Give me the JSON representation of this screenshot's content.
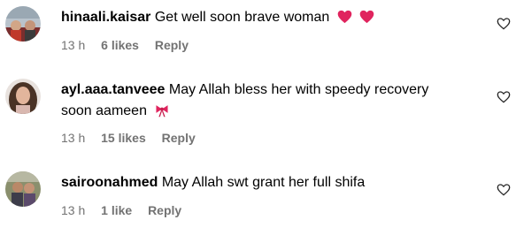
{
  "comments": [
    {
      "username": "hinaali.kaisar",
      "text_line1": "Get well soon brave woman",
      "text_line2": "",
      "emoji": "red-heart-emoji x2",
      "time": "13 h",
      "likes": "6 likes",
      "reply": "Reply"
    },
    {
      "username": "ayl.aaa.tanveee",
      "text_line1": "May Allah bless her with speedy recovery",
      "text_line2": "soon aameen",
      "emoji": "ribbon-emoji",
      "time": "13 h",
      "likes": "15 likes",
      "reply": "Reply"
    },
    {
      "username": "sairoonahmed",
      "text_line1": "May Allah swt grant her full shifa",
      "text_line2": "",
      "emoji": "",
      "time": "13 h",
      "likes": "1 like",
      "reply": "Reply"
    }
  ],
  "colors": {
    "text": "#000000",
    "meta": "#737373",
    "heart_emoji": "#e0245e",
    "ribbon_emoji": "#e0245e"
  },
  "icons": {
    "like": "heart-outline-icon"
  }
}
